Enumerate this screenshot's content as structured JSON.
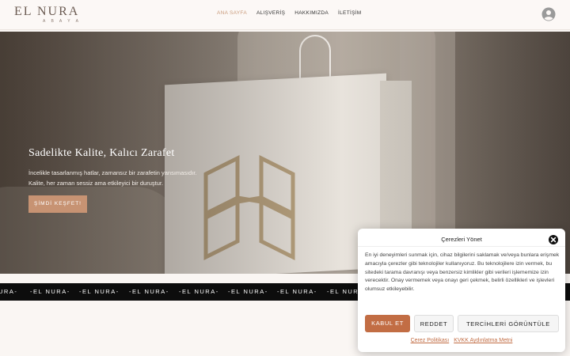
{
  "header": {
    "logo_main": "EL NURA",
    "logo_sub": "A B A Y A",
    "nav": [
      {
        "label": "ANA SAYFA",
        "active": true
      },
      {
        "label": "ALIŞVERİŞ",
        "active": false
      },
      {
        "label": "HAKKIMIZDA",
        "active": false
      },
      {
        "label": "İLETİŞİM",
        "active": false
      }
    ],
    "account_icon": "user-circle-icon"
  },
  "hero": {
    "title": "Sadelikte Kalite, Kalıcı Zarafet",
    "line1": "İncelikle tasarlanmış hatlar, zamansız bir zarafetin yansımasıdır.",
    "line2": "Kalite, her zaman sessiz ama etkileyici bir duruştur.",
    "cta": "ŞİMDİ KEŞFET!"
  },
  "marquee": {
    "items": [
      "URA-",
      "-EL NURA-",
      "-EL NURA-",
      "-EL NURA-",
      "-EL NURA-",
      "-EL NURA-",
      "-EL NURA-",
      "-EL NURA-"
    ]
  },
  "cookie": {
    "title": "Çerezleri Yönet",
    "body": "En iyi deneyimleri sunmak için, cihaz bilgilerini saklamak ve/veya bunlara erişmek amacıyla çerezler gibi teknolojiler kullanıyoruz. Bu teknolojilere izin vermek, bu sitedeki tarama davranışı veya benzersiz kimlikler gibi verileri işlememize izin verecektir. Onay vermemek veya onayı geri çekmek, belirli özellikleri ve işlevleri olumsuz etkileyebilir.",
    "accept": "KABUL ET",
    "reject": "REDDET",
    "prefs": "TERCİHLERİ GÖRÜNTÜLE",
    "link1": "Çerez Politikası",
    "link2": "KVKK Aydınlatma Metni",
    "close_icon": "close-icon",
    "accent": "#c26d44"
  }
}
